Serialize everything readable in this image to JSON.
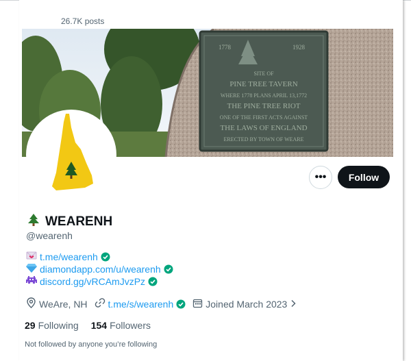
{
  "header": {
    "posts_count": "26.7K posts"
  },
  "profile": {
    "name_emoji": "tree-icon",
    "name": "WEARENH",
    "handle": "@wearenh",
    "actions": {
      "more_label": "•••",
      "follow_label": "Follow"
    }
  },
  "banner": {
    "plaque_lines": [
      "1778",
      "1928",
      "SITE OF",
      "PINE TREE TAVERN",
      "WHERE 1778 PLANS APRIL 13,1772",
      "THE PINE TREE RIOT",
      "ONE OF THE FIRST ACTS AGAINST",
      "THE LAWS OF ENGLAND",
      "ERECTED BY TOWN OF WEARE"
    ]
  },
  "bio": {
    "links": [
      {
        "icon": "love-letter-icon",
        "text": "t.me/wearenh"
      },
      {
        "icon": "gem-icon",
        "text": "diamondapp.com/u/wearenh"
      },
      {
        "icon": "space-invader-icon",
        "text": "discord.gg/vRCAmJvzPz"
      }
    ]
  },
  "meta": {
    "location": "WeAre, NH",
    "website": "t.me/s/wearenh",
    "joined": "Joined March 2023"
  },
  "stats": {
    "following_count": "29",
    "following_label": "Following",
    "followers_count": "154",
    "followers_label": "Followers"
  },
  "footer": {
    "not_followed": "Not followed by anyone you’re following"
  },
  "colors": {
    "link": "#1d9bf0",
    "verified": "#00a57d",
    "nh_yellow": "#f2c814",
    "text_secondary": "#536471"
  }
}
